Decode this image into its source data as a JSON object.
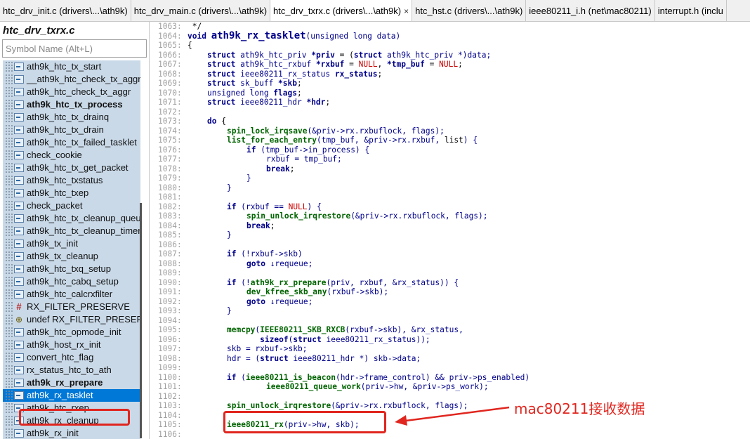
{
  "tabs": [
    {
      "label": "htc_drv_init.c (drivers\\...\\ath9k)",
      "active": false
    },
    {
      "label": "htc_drv_main.c (drivers\\...\\ath9k)",
      "active": false
    },
    {
      "label": "htc_drv_txrx.c (drivers\\...\\ath9k)",
      "active": true
    },
    {
      "label": "htc_hst.c (drivers\\...\\ath9k)",
      "active": false
    },
    {
      "label": "ieee80211_i.h (net\\mac80211)",
      "active": false
    },
    {
      "label": "interrupt.h (inclu",
      "active": false
    }
  ],
  "close_glyph": "×",
  "symbol_panel": {
    "file_title": "htc_drv_txrx.c",
    "search_placeholder": "Symbol Name (Alt+L)",
    "items": [
      {
        "label": "ath9k_htc_tx_start",
        "icon": "function-icon",
        "bold": false
      },
      {
        "label": "__ath9k_htc_check_tx_aggr",
        "icon": "function-icon",
        "bold": false
      },
      {
        "label": "ath9k_htc_check_tx_aggr",
        "icon": "function-icon",
        "bold": false
      },
      {
        "label": "ath9k_htc_tx_process",
        "icon": "function-icon",
        "bold": true
      },
      {
        "label": "ath9k_htc_tx_drainq",
        "icon": "function-icon",
        "bold": false
      },
      {
        "label": "ath9k_htc_tx_drain",
        "icon": "function-icon",
        "bold": false
      },
      {
        "label": "ath9k_htc_tx_failed_tasklet",
        "icon": "function-icon",
        "bold": false
      },
      {
        "label": "check_cookie",
        "icon": "function-icon",
        "bold": false
      },
      {
        "label": "ath9k_htc_tx_get_packet",
        "icon": "function-icon",
        "bold": false
      },
      {
        "label": "ath9k_htc_txstatus",
        "icon": "function-icon",
        "bold": false
      },
      {
        "label": "ath9k_htc_txep",
        "icon": "function-icon",
        "bold": false
      },
      {
        "label": "check_packet",
        "icon": "function-icon",
        "bold": false
      },
      {
        "label": "ath9k_htc_tx_cleanup_queue",
        "icon": "function-icon",
        "bold": false
      },
      {
        "label": "ath9k_htc_tx_cleanup_timer",
        "icon": "function-icon",
        "bold": false
      },
      {
        "label": "ath9k_tx_init",
        "icon": "function-icon",
        "bold": false
      },
      {
        "label": "ath9k_tx_cleanup",
        "icon": "function-icon",
        "bold": false
      },
      {
        "label": "ath9k_htc_txq_setup",
        "icon": "function-icon",
        "bold": false
      },
      {
        "label": "ath9k_htc_cabq_setup",
        "icon": "function-icon",
        "bold": false
      },
      {
        "label": "ath9k_htc_calcrxfilter",
        "icon": "function-icon",
        "bold": false
      },
      {
        "label": "RX_FILTER_PRESERVE",
        "icon": "macro-icon",
        "bold": false
      },
      {
        "label": "undef RX_FILTER_PRESERVE",
        "icon": "undef-icon",
        "bold": false
      },
      {
        "label": "ath9k_htc_opmode_init",
        "icon": "function-icon",
        "bold": false
      },
      {
        "label": "ath9k_host_rx_init",
        "icon": "function-icon",
        "bold": false
      },
      {
        "label": "convert_htc_flag",
        "icon": "function-icon",
        "bold": false
      },
      {
        "label": "rx_status_htc_to_ath",
        "icon": "function-icon",
        "bold": false
      },
      {
        "label": "ath9k_rx_prepare",
        "icon": "function-icon",
        "bold": true
      },
      {
        "label": "ath9k_rx_tasklet",
        "icon": "function-icon",
        "bold": false,
        "selected": true
      },
      {
        "label": "ath9k_htc_rxep",
        "icon": "function-icon",
        "bold": false
      },
      {
        "label": "ath9k_rx_cleanup",
        "icon": "function-icon",
        "bold": false
      },
      {
        "label": "ath9k_rx_init",
        "icon": "function-icon",
        "bold": false
      }
    ]
  },
  "code": {
    "lines": [
      {
        "n": "1063:",
        "indent": 0,
        "parts": [
          {
            "t": " */",
            "c": "code"
          }
        ]
      },
      {
        "n": "1064:",
        "indent": 0,
        "parts": [
          {
            "t": "void ",
            "c": "kw"
          },
          {
            "t": "ath9k_rx_tasklet",
            "c": "fname"
          },
          {
            "t": "(unsigned long ",
            "c": "par"
          },
          {
            "t": "data",
            "c": "par"
          },
          {
            "t": ")",
            "c": "par"
          }
        ]
      },
      {
        "n": "1065:",
        "indent": 0,
        "parts": [
          {
            "t": "{",
            "c": "code"
          }
        ]
      },
      {
        "n": "1066:",
        "indent": 1,
        "parts": [
          {
            "t": "struct ",
            "c": "kw"
          },
          {
            "t": "ath9k_htc_priv ",
            "c": "par"
          },
          {
            "t": "*priv",
            "c": "id"
          },
          {
            "t": " = (",
            "c": "code"
          },
          {
            "t": "struct ",
            "c": "kw"
          },
          {
            "t": "ath9k_htc_priv *",
            "c": "par"
          },
          {
            "t": ")data;",
            "c": "par"
          }
        ]
      },
      {
        "n": "1067:",
        "indent": 1,
        "parts": [
          {
            "t": "struct ",
            "c": "kw"
          },
          {
            "t": "ath9k_htc_rxbuf ",
            "c": "par"
          },
          {
            "t": "*rxbuf",
            "c": "id"
          },
          {
            "t": " = ",
            "c": "code"
          },
          {
            "t": "NULL",
            "c": "nul"
          },
          {
            "t": ", ",
            "c": "code"
          },
          {
            "t": "*tmp_buf",
            "c": "id"
          },
          {
            "t": " = ",
            "c": "code"
          },
          {
            "t": "NULL",
            "c": "nul"
          },
          {
            "t": ";",
            "c": "code"
          }
        ]
      },
      {
        "n": "1068:",
        "indent": 1,
        "parts": [
          {
            "t": "struct ",
            "c": "kw"
          },
          {
            "t": "ieee80211_rx_status ",
            "c": "par"
          },
          {
            "t": "rx_status",
            "c": "id"
          },
          {
            "t": ";",
            "c": "code"
          }
        ]
      },
      {
        "n": "1069:",
        "indent": 1,
        "parts": [
          {
            "t": "struct ",
            "c": "kw"
          },
          {
            "t": "sk_buff ",
            "c": "par"
          },
          {
            "t": "*skb",
            "c": "id"
          },
          {
            "t": ";",
            "c": "code"
          }
        ]
      },
      {
        "n": "1070:",
        "indent": 1,
        "parts": [
          {
            "t": "unsigned long ",
            "c": "par"
          },
          {
            "t": "flags",
            "c": "id"
          },
          {
            "t": ";",
            "c": "code"
          }
        ]
      },
      {
        "n": "1071:",
        "indent": 1,
        "parts": [
          {
            "t": "struct ",
            "c": "kw"
          },
          {
            "t": "ieee80211_hdr ",
            "c": "par"
          },
          {
            "t": "*hdr",
            "c": "id"
          },
          {
            "t": ";",
            "c": "code"
          }
        ]
      },
      {
        "n": "1072:",
        "indent": 0,
        "parts": []
      },
      {
        "n": "1073:",
        "indent": 1,
        "parts": [
          {
            "t": "do",
            "c": "kw"
          },
          {
            "t": " {",
            "c": "code"
          }
        ]
      },
      {
        "n": "1074:",
        "indent": 2,
        "parts": [
          {
            "t": "spin_lock_irqsave",
            "c": "fn"
          },
          {
            "t": "(&priv->rx.rxbuflock, flags);",
            "c": "par"
          }
        ]
      },
      {
        "n": "1075:",
        "indent": 2,
        "parts": [
          {
            "t": "list_for_each_entry",
            "c": "fn"
          },
          {
            "t": "(tmp_buf, &priv->rx.rxbuf, ",
            "c": "par"
          },
          {
            "t": "list",
            "c": "code"
          },
          {
            "t": ") {",
            "c": "par"
          }
        ]
      },
      {
        "n": "1076:",
        "indent": 3,
        "parts": [
          {
            "t": "if",
            "c": "kw"
          },
          {
            "t": " (tmp_buf->in_process) {",
            "c": "par"
          }
        ]
      },
      {
        "n": "1077:",
        "indent": 4,
        "parts": [
          {
            "t": "rxbuf = tmp_buf;",
            "c": "par"
          }
        ]
      },
      {
        "n": "1078:",
        "indent": 4,
        "parts": [
          {
            "t": "break",
            "c": "kw"
          },
          {
            "t": ";",
            "c": "code"
          }
        ]
      },
      {
        "n": "1079:",
        "indent": 3,
        "parts": [
          {
            "t": "}",
            "c": "par"
          }
        ]
      },
      {
        "n": "1080:",
        "indent": 2,
        "parts": [
          {
            "t": "}",
            "c": "par"
          }
        ]
      },
      {
        "n": "1081:",
        "indent": 0,
        "parts": []
      },
      {
        "n": "1082:",
        "indent": 2,
        "parts": [
          {
            "t": "if",
            "c": "kw"
          },
          {
            "t": " (rxbuf == ",
            "c": "par"
          },
          {
            "t": "NULL",
            "c": "nul"
          },
          {
            "t": ") {",
            "c": "par"
          }
        ]
      },
      {
        "n": "1083:",
        "indent": 3,
        "parts": [
          {
            "t": "spin_unlock_irqrestore",
            "c": "fn"
          },
          {
            "t": "(&priv->rx.rxbuflock, flags);",
            "c": "par"
          }
        ]
      },
      {
        "n": "1084:",
        "indent": 3,
        "parts": [
          {
            "t": "break",
            "c": "kw"
          },
          {
            "t": ";",
            "c": "code"
          }
        ]
      },
      {
        "n": "1085:",
        "indent": 2,
        "parts": [
          {
            "t": "}",
            "c": "par"
          }
        ]
      },
      {
        "n": "1086:",
        "indent": 0,
        "parts": []
      },
      {
        "n": "1087:",
        "indent": 2,
        "parts": [
          {
            "t": "if",
            "c": "kw"
          },
          {
            "t": " (!rxbuf->skb)",
            "c": "par"
          }
        ]
      },
      {
        "n": "1088:",
        "indent": 3,
        "parts": [
          {
            "t": "goto",
            "c": "kw"
          },
          {
            "t": " ↓requeue;",
            "c": "par"
          }
        ]
      },
      {
        "n": "1089:",
        "indent": 0,
        "parts": []
      },
      {
        "n": "1090:",
        "indent": 2,
        "parts": [
          {
            "t": "if",
            "c": "kw"
          },
          {
            "t": " (!",
            "c": "par"
          },
          {
            "t": "ath9k_rx_prepare",
            "c": "fn"
          },
          {
            "t": "(priv, rxbuf, &rx_status)) {",
            "c": "par"
          }
        ]
      },
      {
        "n": "1091:",
        "indent": 3,
        "parts": [
          {
            "t": "dev_kfree_skb_any",
            "c": "fn"
          },
          {
            "t": "(rxbuf->skb);",
            "c": "par"
          }
        ]
      },
      {
        "n": "1092:",
        "indent": 3,
        "parts": [
          {
            "t": "goto",
            "c": "kw"
          },
          {
            "t": " ↓requeue;",
            "c": "par"
          }
        ]
      },
      {
        "n": "1093:",
        "indent": 2,
        "parts": [
          {
            "t": "}",
            "c": "par"
          }
        ]
      },
      {
        "n": "1094:",
        "indent": 0,
        "parts": []
      },
      {
        "n": "1095:",
        "indent": 2,
        "parts": [
          {
            "t": "memcpy",
            "c": "fn"
          },
          {
            "t": "(",
            "c": "par"
          },
          {
            "t": "IEEE80211_SKB_RXCB",
            "c": "fn"
          },
          {
            "t": "(rxbuf->skb), &rx_status,",
            "c": "par"
          }
        ]
      },
      {
        "n": "1096:",
        "indent": 2,
        "parts": [
          {
            "t": "       ",
            "c": "code"
          },
          {
            "t": "sizeof",
            "c": "kw"
          },
          {
            "t": "(",
            "c": "par"
          },
          {
            "t": "struct ",
            "c": "kw"
          },
          {
            "t": "ieee80211_rx_status));",
            "c": "par"
          }
        ]
      },
      {
        "n": "1097:",
        "indent": 2,
        "parts": [
          {
            "t": "skb = rxbuf->skb;",
            "c": "par"
          }
        ]
      },
      {
        "n": "1098:",
        "indent": 2,
        "parts": [
          {
            "t": "hdr = (",
            "c": "par"
          },
          {
            "t": "struct ",
            "c": "kw"
          },
          {
            "t": "ieee80211_hdr *) skb->data;",
            "c": "par"
          }
        ]
      },
      {
        "n": "1099:",
        "indent": 0,
        "parts": []
      },
      {
        "n": "1100:",
        "indent": 2,
        "parts": [
          {
            "t": "if",
            "c": "kw"
          },
          {
            "t": " (",
            "c": "par"
          },
          {
            "t": "ieee80211_is_beacon",
            "c": "fn"
          },
          {
            "t": "(hdr->frame_control) && priv->ps_enabled)",
            "c": "par"
          }
        ]
      },
      {
        "n": "1101:",
        "indent": 4,
        "parts": [
          {
            "t": "ieee80211_queue_work",
            "c": "fn"
          },
          {
            "t": "(priv->hw, &priv->ps_work);",
            "c": "par"
          }
        ]
      },
      {
        "n": "1102:",
        "indent": 0,
        "parts": []
      },
      {
        "n": "1103:",
        "indent": 2,
        "parts": [
          {
            "t": "spin_unlock_irqrestore",
            "c": "fn"
          },
          {
            "t": "(&priv->rx.rxbuflock, flags);",
            "c": "par"
          }
        ]
      },
      {
        "n": "1104:",
        "indent": 0,
        "parts": []
      },
      {
        "n": "1105:",
        "indent": 2,
        "parts": [
          {
            "t": "ieee80211_rx",
            "c": "fn"
          },
          {
            "t": "(priv->hw, skb);",
            "c": "par"
          }
        ]
      },
      {
        "n": "1106:",
        "indent": 0,
        "parts": []
      }
    ]
  },
  "annotation": {
    "text": "mac80211接收数据",
    "color": "#e0261f"
  }
}
